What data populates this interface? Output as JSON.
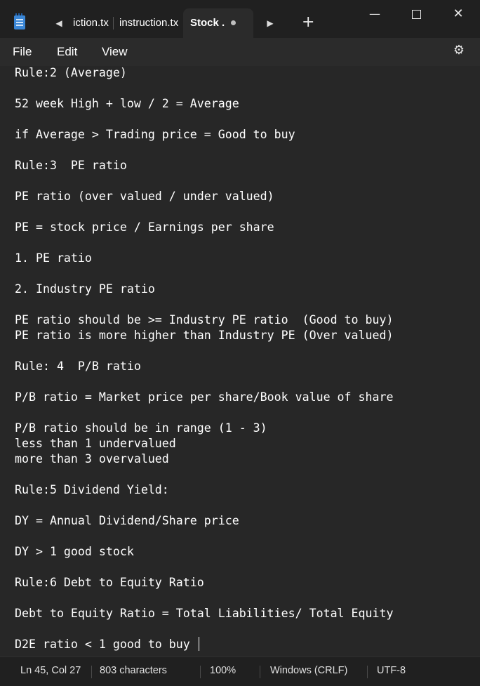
{
  "tabs": [
    {
      "label": "iction.tx"
    },
    {
      "label": "instruction.tx"
    },
    {
      "label": "Stock .",
      "active": true
    }
  ],
  "menu": {
    "file": "File",
    "edit": "Edit",
    "view": "View"
  },
  "editor_lines": [
    "Rule:2 (Average)",
    "",
    "52 week High + low / 2 = Average",
    "",
    "if Average > Trading price = Good to buy",
    "",
    "Rule:3  PE ratio",
    "",
    "PE ratio (over valued / under valued)",
    "",
    "PE = stock price / Earnings per share",
    "",
    "1. PE ratio",
    "",
    "2. Industry PE ratio",
    "",
    "PE ratio should be >= Industry PE ratio  (Good to buy)",
    "PE ratio is more higher than Industry PE (Over valued)",
    "",
    "Rule: 4  P/B ratio",
    "",
    "P/B ratio = Market price per share/Book value of share",
    "",
    "P/B ratio should be in range (1 - 3)",
    "less than 1 undervalued",
    "more than 3 overvalued",
    "",
    "Rule:5 Dividend Yield:",
    "",
    "DY = Annual Dividend/Share price",
    "",
    "DY > 1 good stock",
    "",
    "Rule:6 Debt to Equity Ratio",
    "",
    "Debt to Equity Ratio = Total Liabilities/ Total Equity",
    "",
    "D2E ratio < 1 good to buy "
  ],
  "status": {
    "position": "Ln 45, Col 27",
    "characters": "803 characters",
    "zoom": "100%",
    "line_ending": "Windows (CRLF)",
    "encoding": "UTF-8"
  },
  "icons": {
    "app": "notepad-icon",
    "tab_left": "scroll-left-icon",
    "tab_right": "scroll-right-icon",
    "new_tab": "plus-icon",
    "minimize": "minimize-icon",
    "maximize": "maximize-icon",
    "close": "close-icon",
    "settings": "gear-icon"
  }
}
